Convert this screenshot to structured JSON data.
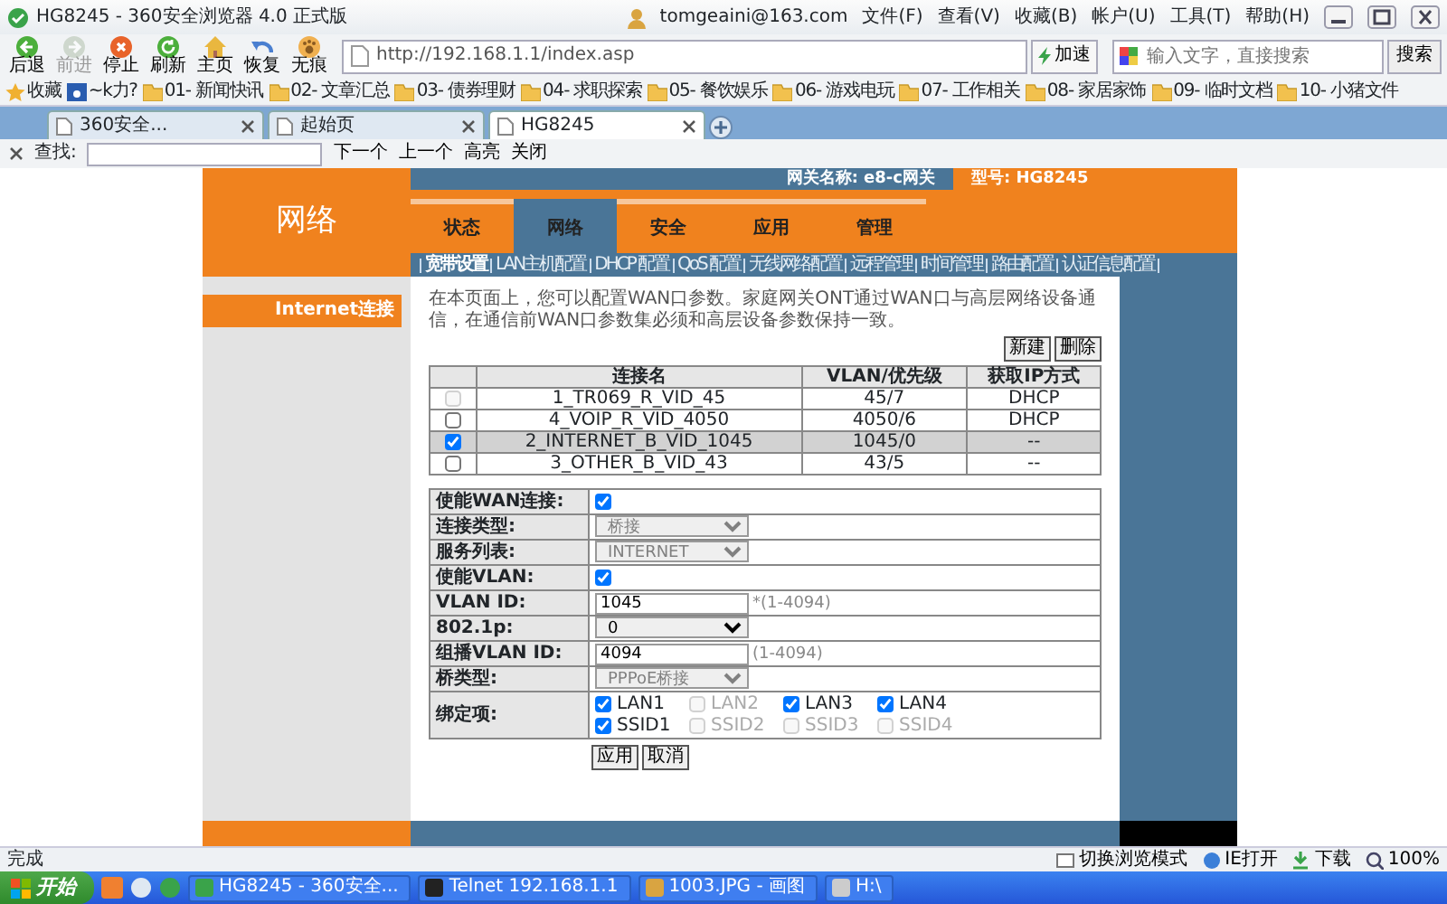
{
  "window": {
    "title": "HG8245 - 360安全浏览器 4.0 正式版",
    "user": "tomgeaini@163.com",
    "menus": [
      "文件(F)",
      "查看(V)",
      "收藏(B)",
      "帐户(U)",
      "工具(T)",
      "帮助(H)"
    ]
  },
  "toolbar": {
    "buttons": [
      {
        "kind": "back",
        "label": "后退",
        "disabled": false
      },
      {
        "kind": "forward",
        "label": "前进",
        "disabled": true
      },
      {
        "kind": "stop",
        "label": "停止",
        "disabled": false
      },
      {
        "kind": "refresh",
        "label": "刷新",
        "disabled": false
      },
      {
        "kind": "home",
        "label": "主页",
        "disabled": false
      },
      {
        "kind": "restore",
        "label": "恢复",
        "disabled": false
      },
      {
        "kind": "private",
        "label": "无痕",
        "disabled": false
      }
    ],
    "address": "http://192.168.1.1/index.asp",
    "speedup": "加速",
    "search_placeholder": "输入文字，直接搜索",
    "search_button": "搜索"
  },
  "bookmarks": [
    {
      "kind": "favorites",
      "label": "收藏"
    },
    {
      "kind": "site",
      "label": "~k力?"
    },
    {
      "kind": "folder",
      "label": "01- 新闻快讯"
    },
    {
      "kind": "folder",
      "label": "02- 文章汇总"
    },
    {
      "kind": "folder",
      "label": "03- 债券理财"
    },
    {
      "kind": "folder",
      "label": "04- 求职探索"
    },
    {
      "kind": "folder",
      "label": "05- 餐饮娱乐"
    },
    {
      "kind": "folder",
      "label": "06- 游戏电玩"
    },
    {
      "kind": "folder",
      "label": "07- 工作相关"
    },
    {
      "kind": "folder",
      "label": "08- 家居家饰"
    },
    {
      "kind": "folder",
      "label": "09- 临时文档"
    },
    {
      "kind": "folder",
      "label": "10- 小猪文件"
    }
  ],
  "tabs": [
    {
      "label": "360安全...",
      "selected": false
    },
    {
      "label": "起始页",
      "selected": false
    },
    {
      "label": "HG8245",
      "selected": true
    }
  ],
  "find_bar": {
    "label": "查找:",
    "buttons": [
      "下一个",
      "上一个",
      "高亮",
      "关闭"
    ]
  },
  "router": {
    "section_title": "网络",
    "gateway_name": "网关名称: e8-c网关",
    "model": "型号: HG8245",
    "tabs": [
      {
        "label": "状态",
        "selected": false
      },
      {
        "label": "网络",
        "selected": true
      },
      {
        "label": "安全",
        "selected": false
      },
      {
        "label": "应用",
        "selected": false
      },
      {
        "label": "管理",
        "selected": false
      }
    ],
    "subtabs": [
      {
        "label": "宽带设置",
        "selected": true
      },
      {
        "label": "LAN主机配置",
        "selected": false
      },
      {
        "label": "DHCP 配置",
        "selected": false
      },
      {
        "label": "QoS 配置",
        "selected": false
      },
      {
        "label": "无线网络配置",
        "selected": false
      },
      {
        "label": "远程管理",
        "selected": false
      },
      {
        "label": "时间管理",
        "selected": false
      },
      {
        "label": "路由配置",
        "selected": false
      },
      {
        "label": "认证信息配置",
        "selected": false
      }
    ],
    "sidebar": [
      {
        "label": "Internet连接",
        "selected": true
      }
    ],
    "description": "在本页面上，您可以配置WAN口参数。家庭网关ONT通过WAN口与高层网络设备通信，在通信前WAN口参数集必须和高层设备参数保持一致。",
    "table_buttons": [
      "新建",
      "删除"
    ],
    "table": {
      "columns": [
        "连接名",
        "VLAN/优先级",
        "获取IP方式"
      ],
      "rows": [
        {
          "checked": false,
          "disabled": true,
          "selected": false,
          "cells": [
            "1_TR069_R_VID_45",
            "45/7",
            "DHCP"
          ]
        },
        {
          "checked": false,
          "disabled": false,
          "selected": false,
          "cells": [
            "4_VOIP_R_VID_4050",
            "4050/6",
            "DHCP"
          ]
        },
        {
          "checked": true,
          "disabled": false,
          "selected": true,
          "cells": [
            "2_INTERNET_B_VID_1045",
            "1045/0",
            "--"
          ]
        },
        {
          "checked": false,
          "disabled": false,
          "selected": false,
          "cells": [
            "3_OTHER_B_VID_43",
            "43/5",
            "--"
          ]
        }
      ]
    },
    "form": [
      {
        "kind": "checkbox",
        "label": "使能WAN连接:",
        "checked": true
      },
      {
        "kind": "select",
        "label": "连接类型:",
        "value": "桥接",
        "disabled": true
      },
      {
        "kind": "select",
        "label": "服务列表:",
        "value": "INTERNET",
        "disabled": true
      },
      {
        "kind": "checkbox",
        "label": "使能VLAN:",
        "checked": true
      },
      {
        "kind": "input",
        "label": "VLAN ID:",
        "value": "1045",
        "hint": "*(1-4094)"
      },
      {
        "kind": "select",
        "label": "802.1p:",
        "value": "0",
        "disabled": false
      },
      {
        "kind": "input",
        "label": "组播VLAN ID:",
        "value": "4094",
        "hint": "(1-4094)"
      },
      {
        "kind": "select",
        "label": "桥类型:",
        "value": "PPPoE桥接",
        "disabled": true
      },
      {
        "kind": "binding",
        "label": "绑定项:",
        "options": [
          {
            "label": "LAN1",
            "checked": true,
            "disabled": false
          },
          {
            "label": "LAN2",
            "checked": false,
            "disabled": true
          },
          {
            "label": "LAN3",
            "checked": true,
            "disabled": false
          },
          {
            "label": "LAN4",
            "checked": true,
            "disabled": false
          },
          {
            "label": "SSID1",
            "checked": true,
            "disabled": false
          },
          {
            "label": "SSID2",
            "checked": false,
            "disabled": true
          },
          {
            "label": "SSID3",
            "checked": false,
            "disabled": true
          },
          {
            "label": "SSID4",
            "checked": false,
            "disabled": true
          }
        ]
      }
    ],
    "form_buttons": [
      "应用",
      "取消"
    ]
  },
  "status_bar": {
    "text": "完成",
    "items": [
      "切换浏览模式",
      "IE打开",
      "下载",
      "100%"
    ]
  },
  "taskbar": {
    "start": "开始",
    "tasks": [
      "HG8245 - 360安全...",
      "Telnet 192.168.1.1",
      "1003.JPG - 画图",
      "H:\\"
    ]
  }
}
